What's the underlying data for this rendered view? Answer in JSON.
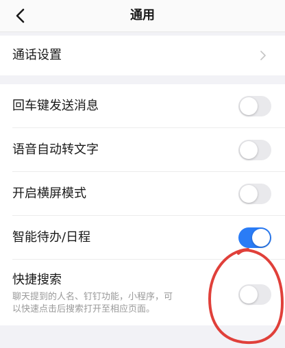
{
  "header": {
    "title": "通用",
    "back_icon": "chevron-left-icon"
  },
  "settings": {
    "call_settings": {
      "label": "通话设置",
      "icon": "chevron-right-icon"
    },
    "enter_to_send": {
      "label": "回车键发送消息",
      "enabled": false
    },
    "voice_to_text": {
      "label": "语音自动转文字",
      "enabled": false
    },
    "landscape_mode": {
      "label": "开启横屏模式",
      "enabled": false
    },
    "smart_todo": {
      "label": "智能待办/日程",
      "enabled": true
    },
    "quick_search": {
      "label": "快捷搜索",
      "description_line1": "聊天提到的人名、钉钉功能，小程序，可",
      "description_line2": "以快速点击后搜索打开至相应页面。",
      "enabled": false
    }
  },
  "colors": {
    "toggle_on": "#2a7cf6",
    "toggle_off": "#e9e9ec",
    "annotation_circle": "#e0403a"
  }
}
